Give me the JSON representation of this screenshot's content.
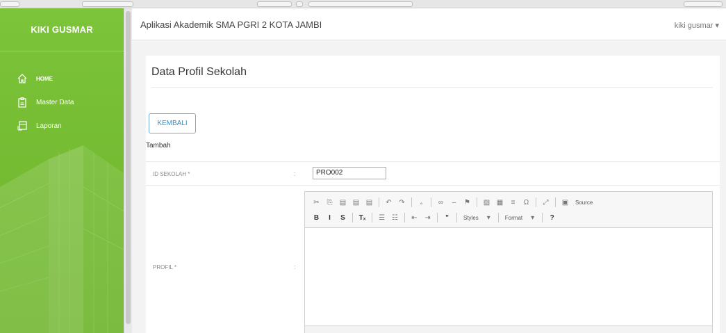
{
  "sidebar": {
    "brand": "KIKI GUSMAR",
    "items": [
      {
        "label": "HOME",
        "icon": "home-icon"
      },
      {
        "label": "Master Data",
        "icon": "clipboard-icon"
      },
      {
        "label": "Laporan",
        "icon": "report-icon"
      }
    ],
    "color": "#7cc43a"
  },
  "header": {
    "app_title": "Aplikasi Akademik SMA PGRI 2 KOTA JAMBI",
    "user_menu": "kiki gusmar ▾"
  },
  "panel": {
    "title": "Data Profil Sekolah",
    "back_button": "KEMBALI",
    "subtitle": "Tambah",
    "fields": {
      "id_label": "ID SEKOLAH *",
      "id_value": "PRO002",
      "profil_label": "PROFIL *",
      "colon": ":"
    }
  },
  "editor": {
    "row1": [
      {
        "name": "cut-icon",
        "glyph": "✂"
      },
      {
        "name": "copy-icon",
        "glyph": "⎘"
      },
      {
        "name": "paste-icon",
        "glyph": "▤"
      },
      {
        "name": "paste-text-icon",
        "glyph": "▤"
      },
      {
        "name": "paste-word-icon",
        "glyph": "▤"
      },
      {
        "sep": true
      },
      {
        "name": "undo-icon",
        "glyph": "↶"
      },
      {
        "name": "redo-icon",
        "glyph": "↷"
      },
      {
        "sep": true
      },
      {
        "name": "spellcheck-icon",
        "glyph": "૰"
      },
      {
        "sep": true
      },
      {
        "name": "link-icon",
        "glyph": "∞"
      },
      {
        "name": "unlink-icon",
        "glyph": "‒"
      },
      {
        "name": "anchor-icon",
        "glyph": "⚑"
      },
      {
        "sep": true
      },
      {
        "name": "image-icon",
        "glyph": "▨"
      },
      {
        "name": "table-icon",
        "glyph": "▦"
      },
      {
        "name": "horizontal-line-icon",
        "glyph": "≡"
      },
      {
        "name": "special-char-icon",
        "glyph": "Ω"
      },
      {
        "sep": true
      },
      {
        "name": "maximize-icon",
        "glyph": "⤢"
      },
      {
        "sep": true
      },
      {
        "name": "source-icon",
        "glyph": "▣"
      },
      {
        "name": "source-label",
        "text": "Source"
      }
    ],
    "row2": [
      {
        "name": "bold-icon",
        "glyph": "B",
        "dark": true
      },
      {
        "name": "italic-icon",
        "glyph": "I",
        "dark": true
      },
      {
        "name": "strike-icon",
        "glyph": "S",
        "dark": true
      },
      {
        "sep": true
      },
      {
        "name": "remove-format-icon",
        "glyph": "Tₓ",
        "dark": true
      },
      {
        "sep": true
      },
      {
        "name": "numbered-list-icon",
        "glyph": "☰"
      },
      {
        "name": "bulleted-list-icon",
        "glyph": "☷"
      },
      {
        "sep": true
      },
      {
        "name": "outdent-icon",
        "glyph": "⇤"
      },
      {
        "name": "indent-icon",
        "glyph": "⇥"
      },
      {
        "sep": true
      },
      {
        "name": "blockquote-icon",
        "glyph": "”",
        "dark": true
      },
      {
        "sep": true
      },
      {
        "name": "styles-dropdown",
        "text": "Styles"
      },
      {
        "name": "styles-arrow",
        "glyph": "▾"
      },
      {
        "sep": true
      },
      {
        "name": "format-dropdown",
        "text": "Format"
      },
      {
        "name": "format-arrow",
        "glyph": "▾"
      },
      {
        "sep": true
      },
      {
        "name": "help-icon",
        "glyph": "?",
        "dark": true
      }
    ]
  }
}
